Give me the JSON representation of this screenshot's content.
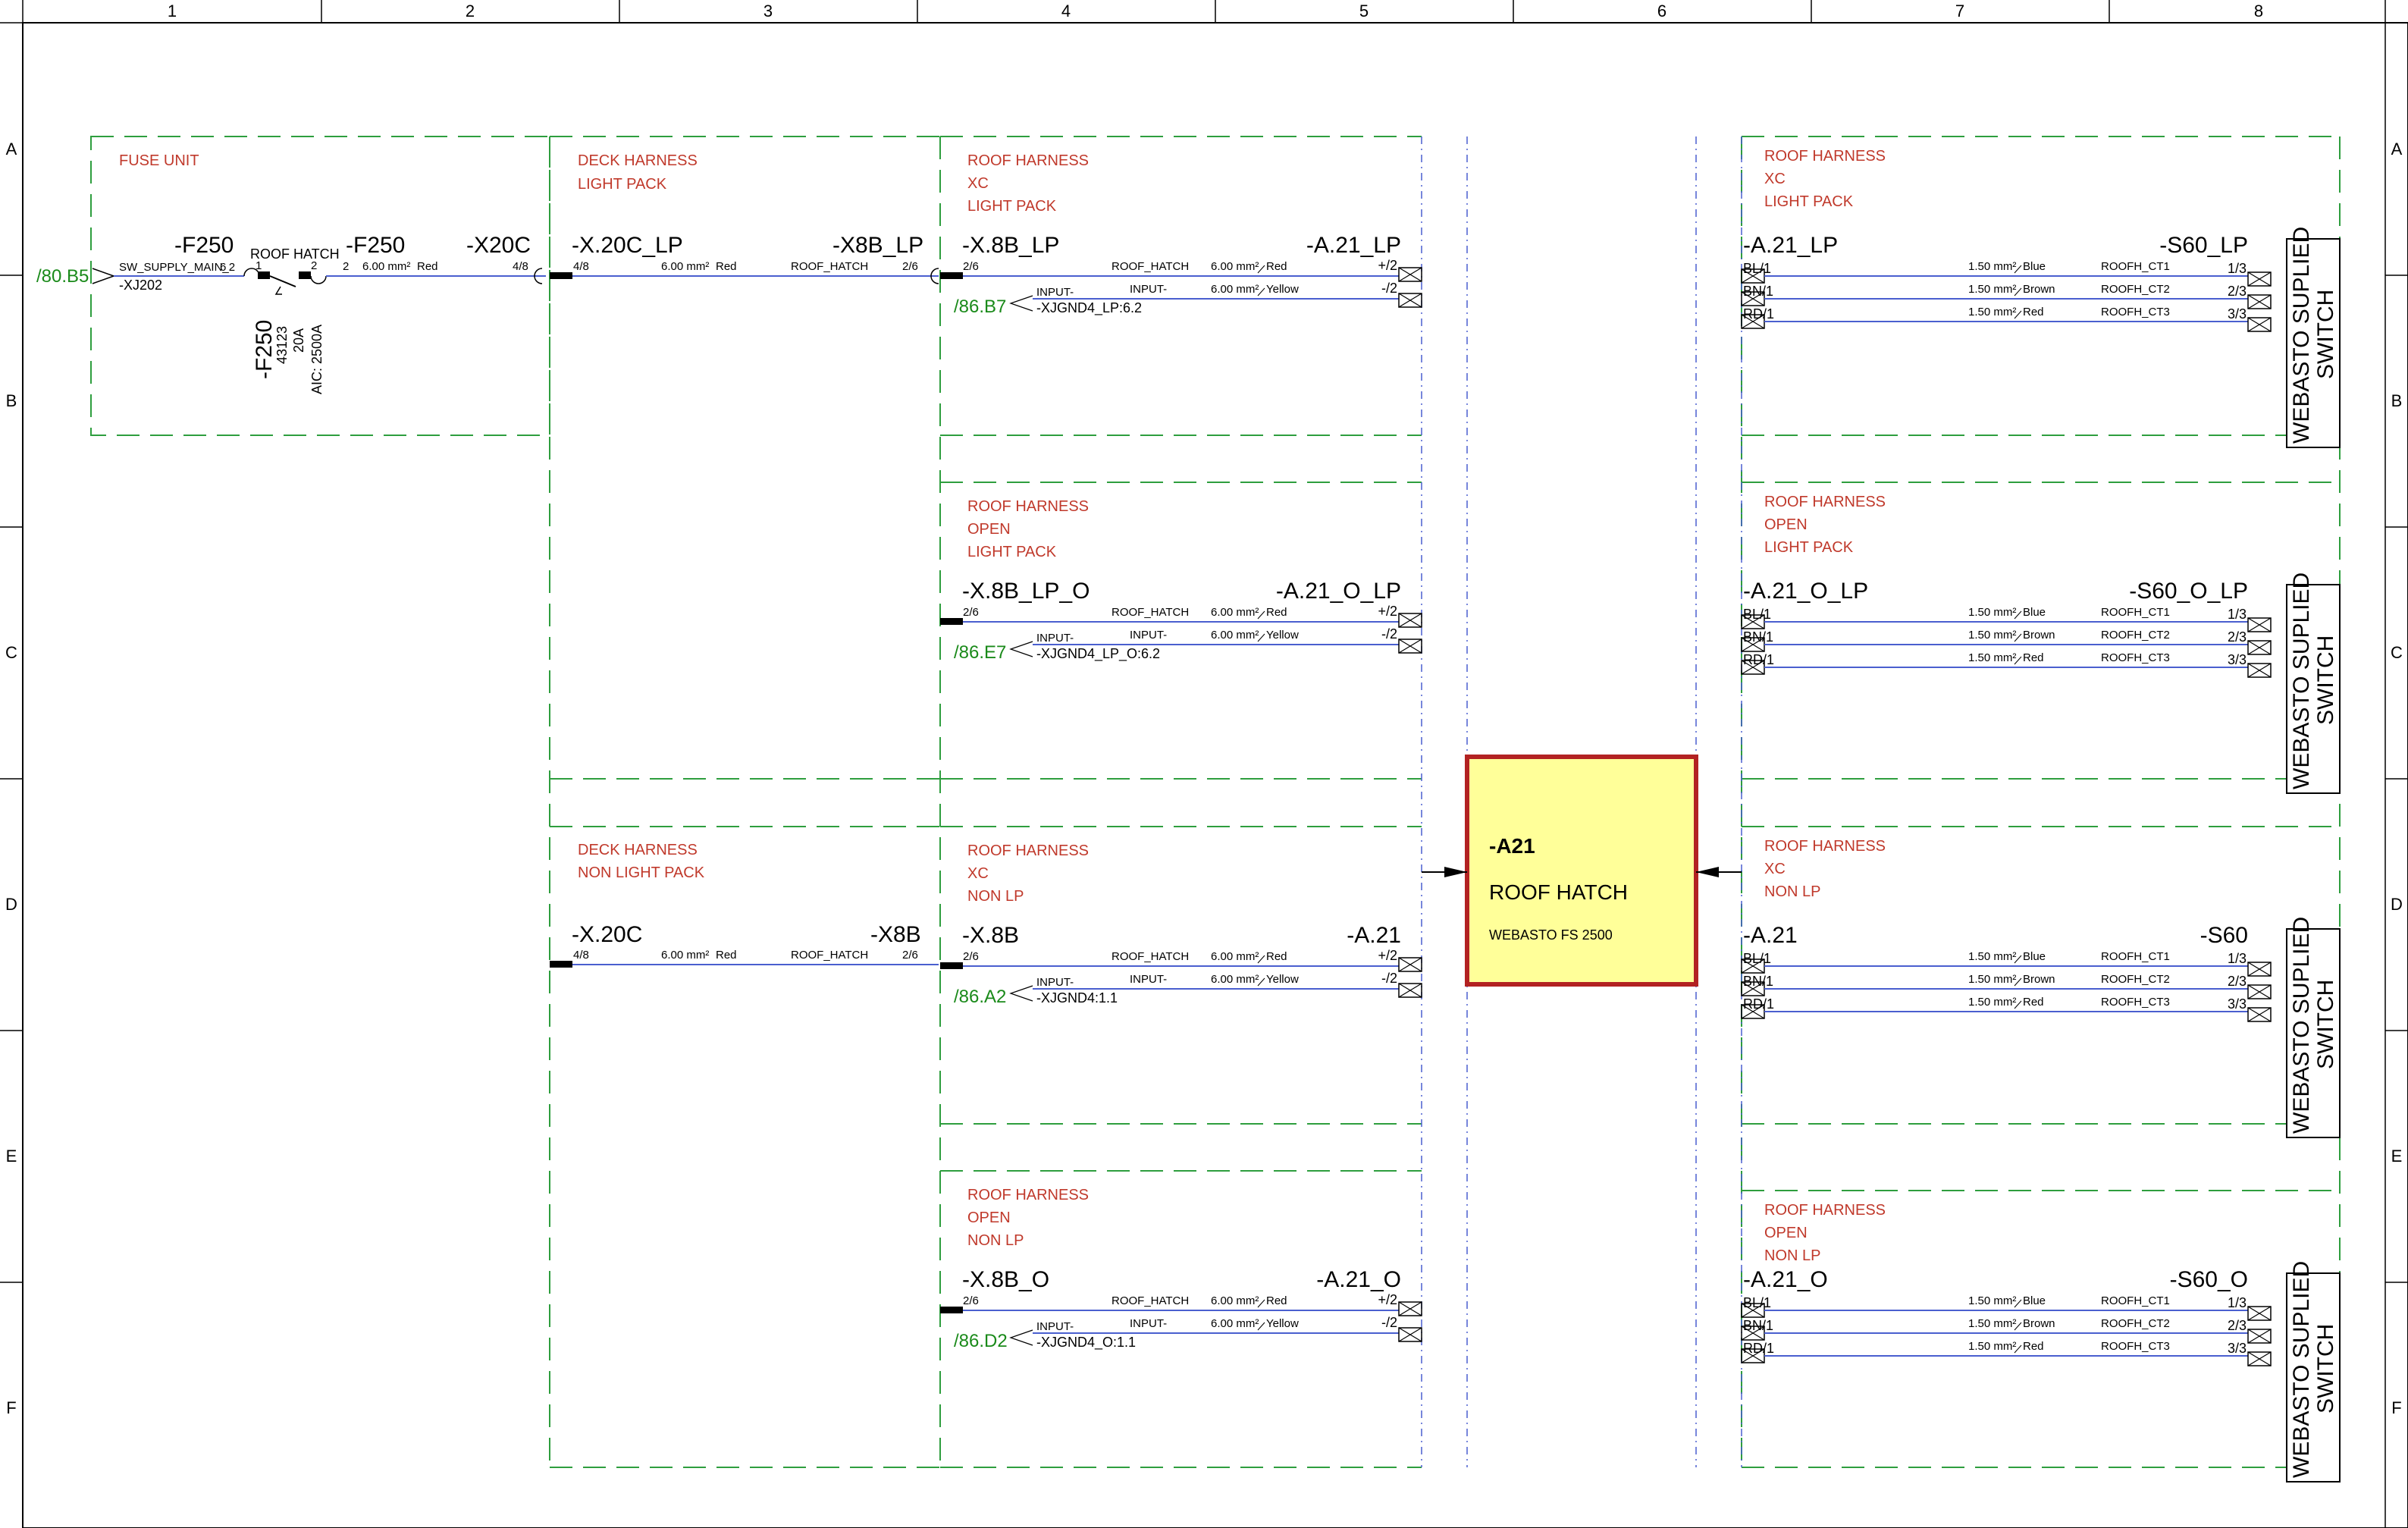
{
  "title_block": {
    "columns": [
      "1",
      "2",
      "3",
      "4",
      "5",
      "6",
      "7",
      "8"
    ],
    "rows": [
      "A",
      "B",
      "C",
      "D",
      "E",
      "F"
    ]
  },
  "fuse_unit": {
    "header": "FUSE UNIT",
    "ref_in": "/80.B5",
    "supply_label": "SW_SUPPLY_MAIN_2",
    "supply_pin": "6",
    "connector": "-XJ202",
    "fuse_left": "-F250",
    "fuse_right": "-F250",
    "fuse_caption": "ROOF HATCH",
    "pin_1": "1",
    "pin_2": "2",
    "pin_2b": "2",
    "wire_size": "6.00 mm²",
    "wire_color": "Red",
    "x20c": "-X20C",
    "x20c_pin": "4/8",
    "fuse_vertical": "-F250",
    "fuse_part": "43123",
    "fuse_rating": "20A",
    "fuse_aic": "AIC: 2500A"
  },
  "deck_lp": {
    "header_1": "DECK HARNESS",
    "header_2": "LIGHT PACK",
    "left": "-X.20C_LP",
    "left_pin": "4/8",
    "right": "-X8B_LP",
    "right_pin": "2/6",
    "wire_size": "6.00 mm²",
    "wire_color": "Red",
    "wire_name": "ROOF_HATCH"
  },
  "deck_nlp": {
    "header_1": "DECK HARNESS",
    "header_2": "NON LIGHT PACK",
    "left": "-X.20C",
    "left_pin": "4/8",
    "right": "-X8B",
    "right_pin": "2/6",
    "wire_size": "6.00 mm²",
    "wire_color": "Red",
    "wire_name": "ROOF_HATCH"
  },
  "roof_blocks": [
    {
      "h1": "ROOF HARNESS",
      "h2": "XC",
      "h3": "LIGHT PACK",
      "left": "-X.8B_LP",
      "left_pin": "2/6",
      "right": "-A.21_LP",
      "ref": "/86.B7",
      "gnd": "-XJGND4_LP:6.2",
      "w1_name": "ROOF_HATCH",
      "w1_size": "6.00 mm²",
      "w1_color": "Red",
      "w1_pin": "+/2",
      "w2_in": "INPUT-",
      "w2_name": "INPUT-",
      "w2_size": "6.00 mm²",
      "w2_color": "Yellow",
      "w2_pin": "-/2"
    },
    {
      "h1": "ROOF HARNESS",
      "h2": "OPEN",
      "h3": "LIGHT PACK",
      "left": "-X.8B_LP_O",
      "left_pin": "2/6",
      "right": "-A.21_O_LP",
      "ref": "/86.E7",
      "gnd": "-XJGND4_LP_O:6.2",
      "w1_name": "ROOF_HATCH",
      "w1_size": "6.00 mm²",
      "w1_color": "Red",
      "w1_pin": "+/2",
      "w2_in": "INPUT-",
      "w2_name": "INPUT-",
      "w2_size": "6.00 mm²",
      "w2_color": "Yellow",
      "w2_pin": "-/2"
    },
    {
      "h1": "ROOF HARNESS",
      "h2": "XC",
      "h3": "NON LP",
      "left": "-X.8B",
      "left_pin": "2/6",
      "right": "-A.21",
      "ref": "/86.A2",
      "gnd": "-XJGND4:1.1",
      "w1_name": "ROOF_HATCH",
      "w1_size": "6.00 mm²",
      "w1_color": "Red",
      "w1_pin": "+/2",
      "w2_in": "INPUT-",
      "w2_name": "INPUT-",
      "w2_size": "6.00 mm²",
      "w2_color": "Yellow",
      "w2_pin": "-/2"
    },
    {
      "h1": "ROOF HARNESS",
      "h2": "OPEN",
      "h3": "NON LP",
      "left": "-X.8B_O",
      "left_pin": "2/6",
      "right": "-A.21_O",
      "ref": "/86.D2",
      "gnd": "-XJGND4_O:1.1",
      "w1_name": "ROOF_HATCH",
      "w1_size": "6.00 mm²",
      "w1_color": "Red",
      "w1_pin": "+/2",
      "w2_in": "INPUT-",
      "w2_name": "INPUT-",
      "w2_size": "6.00 mm²",
      "w2_color": "Yellow",
      "w2_pin": "-/2"
    }
  ],
  "device": {
    "tag": "-A21",
    "name": "ROOF HATCH",
    "model": "WEBASTO FS 2500",
    "fill": "#ffff99",
    "border": "#b22222"
  },
  "switch_blocks": [
    {
      "h1": "ROOF HARNESS",
      "h2": "XC",
      "h3": "LIGHT PACK",
      "left": "-A.21_LP",
      "right": "-S60_LP"
    },
    {
      "h1": "ROOF HARNESS",
      "h2": "OPEN",
      "h3": "LIGHT PACK",
      "left": "-A.21_O_LP",
      "right": "-S60_O_LP"
    },
    {
      "h1": "ROOF HARNESS",
      "h2": "XC",
      "h3": "NON LP",
      "left": "-A.21",
      "right": "-S60"
    },
    {
      "h1": "ROOF HARNESS",
      "h2": "OPEN",
      "h3": "NON LP",
      "left": "-A.21_O",
      "right": "-S60_O"
    }
  ],
  "switch_wires": [
    {
      "pin_l": "BL/1",
      "size": "1.50 mm²",
      "color": "Blue",
      "name": "ROOFH_CT1",
      "pin_r": "1/3"
    },
    {
      "pin_l": "BN/1",
      "size": "1.50 mm²",
      "color": "Brown",
      "name": "ROOFH_CT2",
      "pin_r": "2/3"
    },
    {
      "pin_l": "RD/1",
      "size": "1.50 mm²",
      "color": "Red",
      "name": "ROOFH_CT3",
      "pin_r": "3/3"
    }
  ],
  "switch_label_1": "WEBASTO SUPLIED",
  "switch_label_2": "SWITCH",
  "colors": {
    "frame_dash": "#2e9e3e",
    "wire": "#4a5fcf",
    "header_text": "#c0392b",
    "ref_text": "#1a8a1a"
  }
}
